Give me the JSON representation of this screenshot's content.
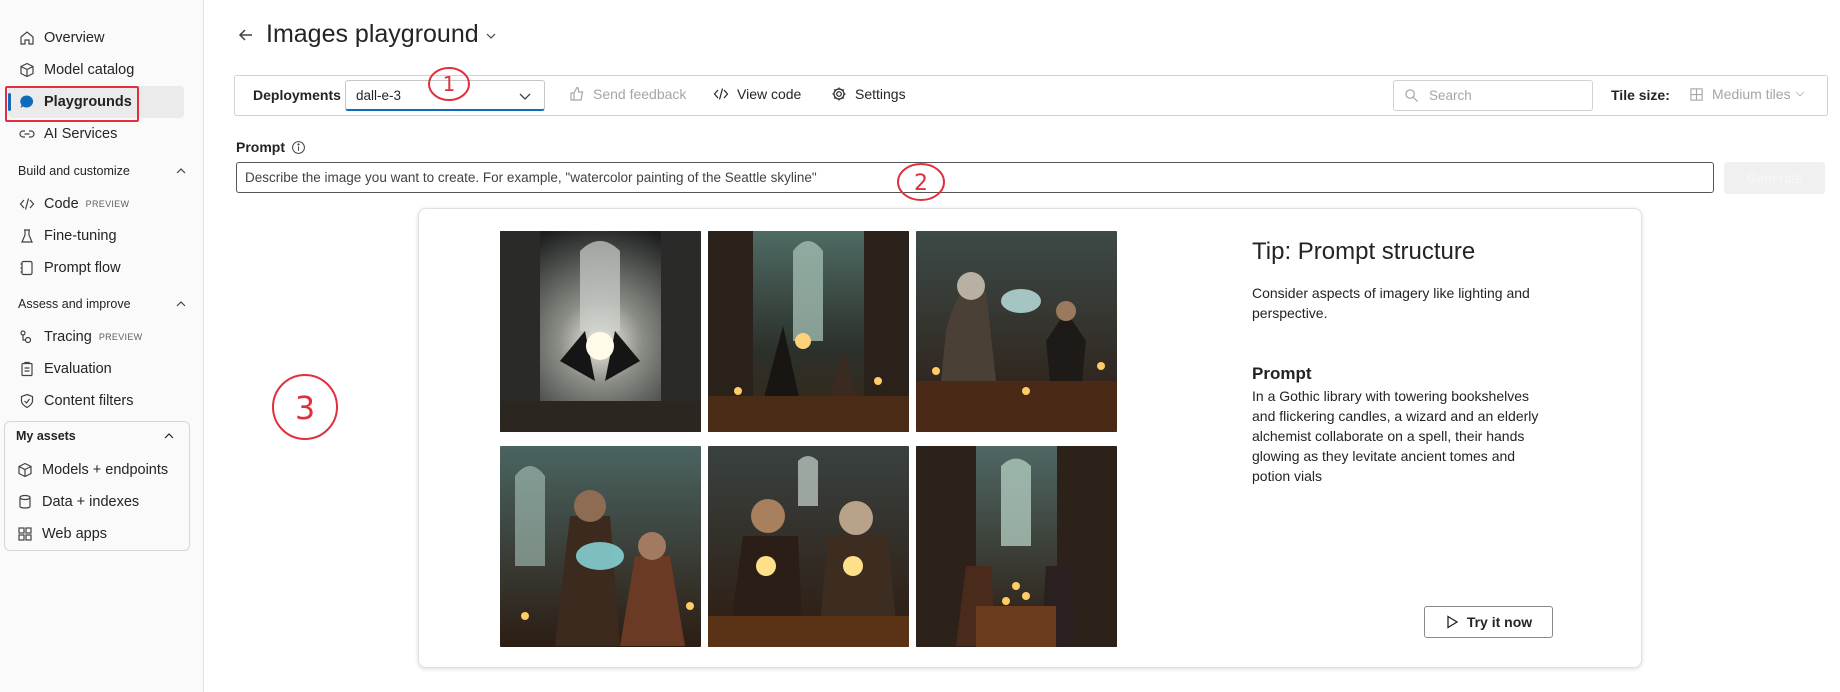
{
  "sidebar": {
    "items": [
      {
        "label": "Overview",
        "icon": "home-icon"
      },
      {
        "label": "Model catalog",
        "icon": "cube-icon"
      },
      {
        "label": "Playgrounds",
        "icon": "chat-icon",
        "active": true
      },
      {
        "label": "AI Services",
        "icon": "link-icon"
      }
    ],
    "build_section": "Build and customize",
    "build_items": [
      {
        "label": "Code",
        "tag": "PREVIEW",
        "icon": "code-icon"
      },
      {
        "label": "Fine-tuning",
        "icon": "beaker-icon"
      },
      {
        "label": "Prompt flow",
        "icon": "flow-icon"
      }
    ],
    "assess_section": "Assess and improve",
    "assess_items": [
      {
        "label": "Tracing",
        "tag": "PREVIEW",
        "icon": "tracing-icon"
      },
      {
        "label": "Evaluation",
        "icon": "clipboard-icon"
      },
      {
        "label": "Content filters",
        "icon": "shield-icon"
      }
    ],
    "assets_section": "My assets",
    "assets_items": [
      {
        "label": "Models + endpoints",
        "icon": "cube-icon"
      },
      {
        "label": "Data + indexes",
        "icon": "database-icon"
      },
      {
        "label": "Web apps",
        "icon": "apps-icon"
      }
    ]
  },
  "header": {
    "title": "Images playground"
  },
  "toolbar": {
    "deployments_label": "Deployments",
    "deployment_value": "dall-e-3",
    "send_feedback": "Send feedback",
    "view_code": "View code",
    "settings": "Settings",
    "search_placeholder": "Search",
    "tile_size_label": "Tile size:",
    "tile_size_value": "Medium tiles"
  },
  "prompt": {
    "label": "Prompt",
    "placeholder": "Describe the image you want to create. For example, \"watercolor painting of the Seattle skyline\"",
    "generate_label": "Generate"
  },
  "tip": {
    "title": "Tip: Prompt structure",
    "description": "Consider aspects of imagery like lighting and perspective.",
    "prompt_heading": "Prompt",
    "prompt_text": "In a Gothic library with towering bookshelves and flickering candles, a wizard and an elderly alchemist collaborate on a spell, their hands glowing as they levitate ancient tomes and potion vials",
    "try_button": "Try it now"
  },
  "annotations": [
    "1",
    "2",
    "3"
  ],
  "colors": {
    "accent": "#0f6cbd",
    "annotation_red": "#e0303d"
  }
}
